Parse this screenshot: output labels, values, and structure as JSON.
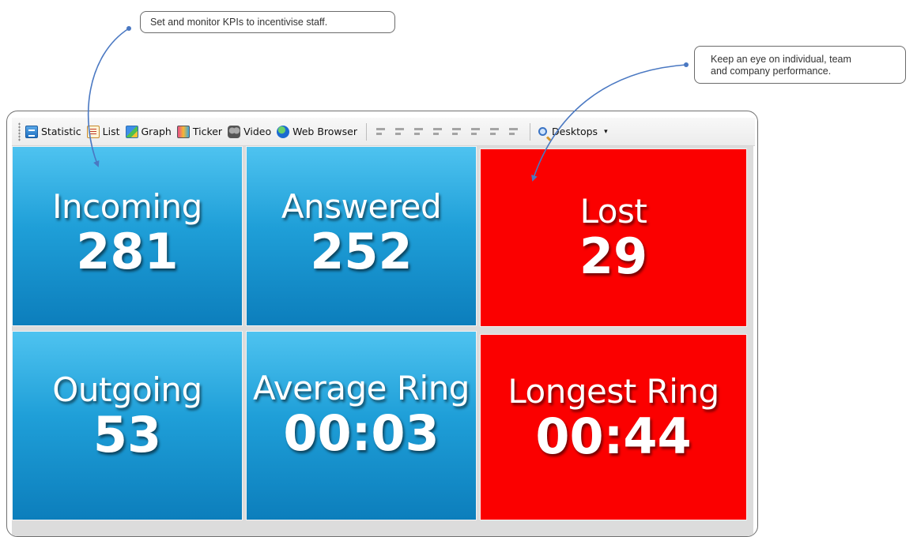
{
  "callouts": [
    {
      "text": "Set and monitor KPIs to incentivise staff."
    },
    {
      "line1": "Keep an eye on individual, team",
      "line2": "and company performance."
    }
  ],
  "toolbar": {
    "items": [
      {
        "label": "Statistic",
        "icon": "statistic-icon"
      },
      {
        "label": "List",
        "icon": "list-icon"
      },
      {
        "label": "Graph",
        "icon": "graph-icon"
      },
      {
        "label": "Ticker",
        "icon": "ticker-icon"
      },
      {
        "label": "Video",
        "icon": "video-icon"
      },
      {
        "label": "Web Browser",
        "icon": "web-browser-icon"
      }
    ],
    "desktops_label": "Desktops",
    "desktops_caret": "▾"
  },
  "tiles": [
    {
      "label": "Incoming",
      "value": "281",
      "color": "#1f9fd8"
    },
    {
      "label": "Answered",
      "value": "252",
      "color": "#1f9fd8"
    },
    {
      "label": "Lost",
      "value": "29",
      "color": "#fb0000"
    },
    {
      "label": "Outgoing",
      "value": "53",
      "color": "#1f9fd8"
    },
    {
      "label": "Average Ring",
      "value": "00:03",
      "color": "#1f9fd8"
    },
    {
      "label": "Longest Ring",
      "value": "00:44",
      "color": "#fb0000"
    }
  ],
  "colors": {
    "accent_blue": "#1f9fd8",
    "alert_red": "#fb0000",
    "arrow": "#4a78c2"
  }
}
